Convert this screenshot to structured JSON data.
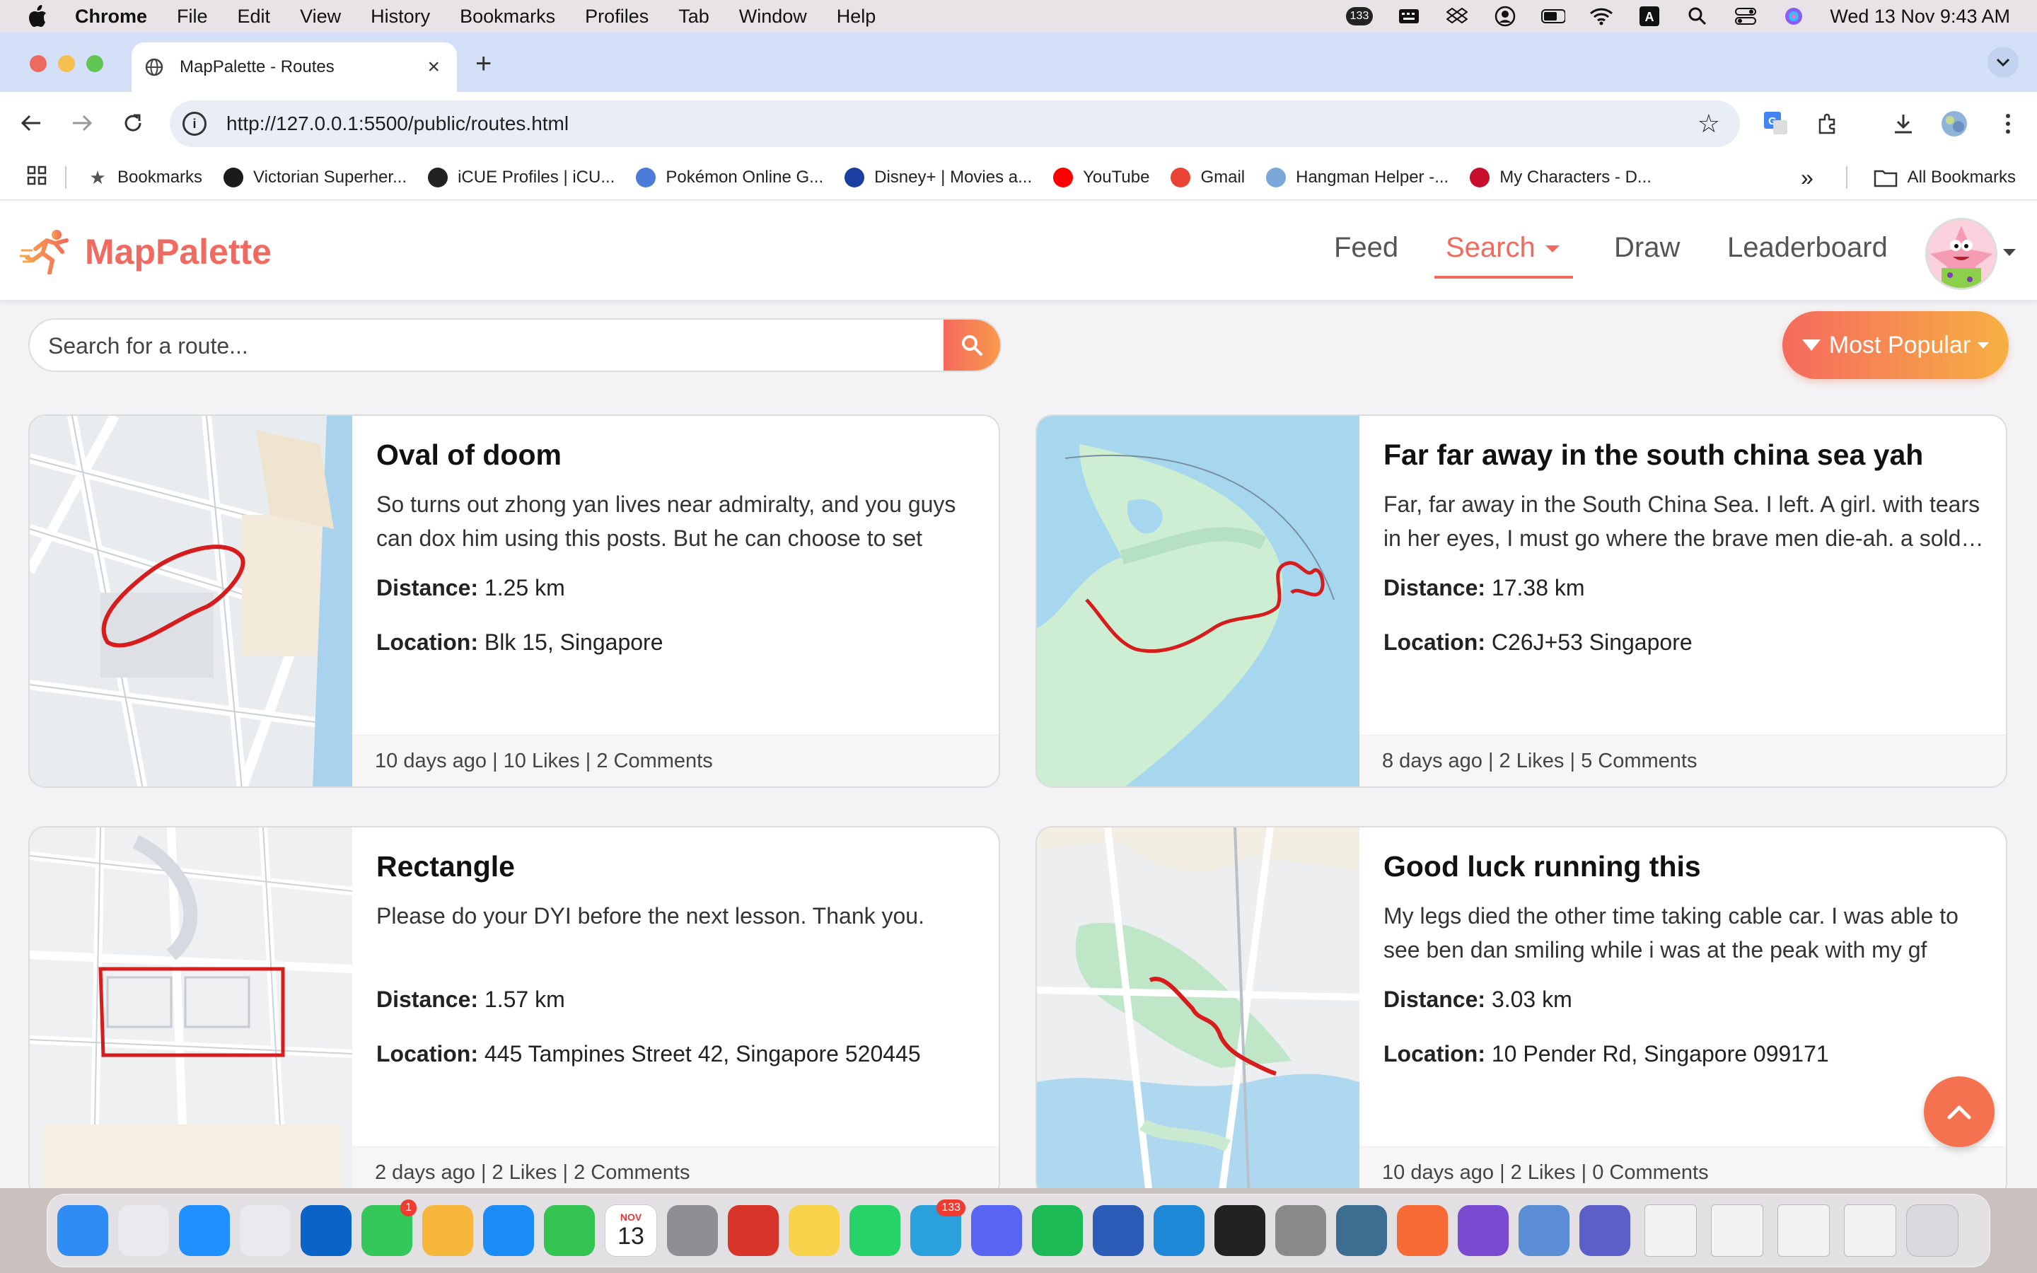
{
  "menubar": {
    "app_name": "Chrome",
    "items": [
      "File",
      "Edit",
      "View",
      "History",
      "Bookmarks",
      "Profiles",
      "Tab",
      "Window",
      "Help"
    ],
    "notification_count": "133",
    "date_time": "Wed 13 Nov  9:43 AM"
  },
  "browser": {
    "tab_title": "MapPalette - Routes",
    "url": "http://127.0.0.1:5500/public/routes.html",
    "bookmarks": [
      {
        "label": "Bookmarks",
        "icon": "star-icon",
        "color": "#555555"
      },
      {
        "label": "Victorian Superher...",
        "icon": "tumblr-icon",
        "color": "#1b1b1b"
      },
      {
        "label": "iCUE Profiles | iCU...",
        "icon": "icue-icon",
        "color": "#222222"
      },
      {
        "label": "Pokémon Online G...",
        "icon": "pokemon-icon",
        "color": "#4a7bd8"
      },
      {
        "label": "Disney+ | Movies a...",
        "icon": "disney-icon",
        "color": "#1b3fa0"
      },
      {
        "label": "YouTube",
        "icon": "youtube-icon",
        "color": "#ff0000"
      },
      {
        "label": "Gmail",
        "icon": "gmail-icon",
        "color": "#ea4335"
      },
      {
        "label": "Hangman Helper -...",
        "icon": "hangman-icon",
        "color": "#7ba7d8"
      },
      {
        "label": "My Characters - D...",
        "icon": "dndbeyond-icon",
        "color": "#c8102e"
      }
    ],
    "more_bookmarks": "»",
    "all_bookmarks": "All Bookmarks"
  },
  "app": {
    "brand": "MapPalette",
    "accent": "#f06a5f",
    "nav": [
      {
        "label": "Feed"
      },
      {
        "label": "Search"
      },
      {
        "label": "Draw"
      },
      {
        "label": "Leaderboard"
      }
    ],
    "search_placeholder": "Search for a route...",
    "sort_label": "Most Popular"
  },
  "labels": {
    "distance": "Distance:",
    "location": "Location:"
  },
  "routes": [
    {
      "title": "Oval of doom",
      "description": "So turns out zhong yan lives near admiralty, and you guys can dox him using this posts. But he can choose to set his…",
      "distance": "1.25 km",
      "location": "Blk 15, Singapore",
      "footer": "10 days ago | 10 Likes | 2 Comments"
    },
    {
      "title": "Far far away in the south china sea yah",
      "description": "Far, far away in the South China Sea. I left. A girl. with tears in her eyes, I must go where the brave men die-ah. a sold…",
      "distance": "17.38 km",
      "location": "C26J+53 Singapore",
      "footer": "8 days ago | 2 Likes | 5 Comments"
    },
    {
      "title": "Rectangle",
      "description": "Please do your DYI before the next lesson. Thank you.",
      "distance": "1.57 km",
      "location": "445 Tampines Street 42, Singapore 520445",
      "footer": "2 days ago | 2 Likes | 2 Comments"
    },
    {
      "title": "Good luck running this",
      "description": "My legs died the other time taking cable car. I was able to see ben dan smiling while i was at the peak with my gf",
      "distance": "3.03 km",
      "location": "10 Pender Rd, Singapore 099171",
      "footer": "10 days ago | 2 Likes | 0 Comments"
    }
  ],
  "dock": {
    "apps": [
      {
        "name": "finder-icon",
        "color": "#2f8cf5"
      },
      {
        "name": "launchpad-icon",
        "color": "#e9e9ee"
      },
      {
        "name": "safari-icon",
        "color": "#1e90ff"
      },
      {
        "name": "chrome-icon",
        "color": "#e8eaed"
      },
      {
        "name": "outlook-icon",
        "color": "#0a64c8"
      },
      {
        "name": "messages-icon",
        "color": "#34c759",
        "badge": "1"
      },
      {
        "name": "photos-icon",
        "color": "#f6b73c"
      },
      {
        "name": "app-store-icon",
        "color": "#1b8cf6"
      },
      {
        "name": "facetime-icon",
        "color": "#33c452"
      },
      {
        "name": "calendar-icon",
        "color": "#ffffff"
      },
      {
        "name": "system-settings-icon",
        "color": "#8e8e93"
      },
      {
        "name": "photo-booth-icon",
        "color": "#d8352a"
      },
      {
        "name": "notes-icon",
        "color": "#f7d24a"
      },
      {
        "name": "whatsapp-icon",
        "color": "#25d366"
      },
      {
        "name": "telegram-icon",
        "color": "#2aa1dc",
        "badge": "133"
      },
      {
        "name": "discord-icon",
        "color": "#5865f2"
      },
      {
        "name": "spotify-icon",
        "color": "#1db954"
      },
      {
        "name": "word-icon",
        "color": "#2b5cb8"
      },
      {
        "name": "vscode-icon",
        "color": "#1e88d8"
      },
      {
        "name": "terminal-icon",
        "color": "#222222"
      },
      {
        "name": "tableplus-icon",
        "color": "#8a8a8a"
      },
      {
        "name": "mysql-workbench-icon",
        "color": "#3b6e91"
      },
      {
        "name": "postman-icon",
        "color": "#f76935"
      },
      {
        "name": "github-desktop-icon",
        "color": "#7a4bd1"
      },
      {
        "name": "preview-icon",
        "color": "#5a8dd6"
      },
      {
        "name": "teams-icon",
        "color": "#5b5fc7"
      },
      {
        "name": "window-thumb-icon",
        "color": "#f2f2f2"
      },
      {
        "name": "window-thumb-icon",
        "color": "#f2f2f2"
      },
      {
        "name": "window-thumb-icon",
        "color": "#f2f2f2"
      },
      {
        "name": "window-thumb-icon",
        "color": "#f2f2f2"
      },
      {
        "name": "trash-icon",
        "color": "#d9d9de"
      }
    ],
    "calendar_month": "NOV",
    "calendar_day": "13"
  }
}
